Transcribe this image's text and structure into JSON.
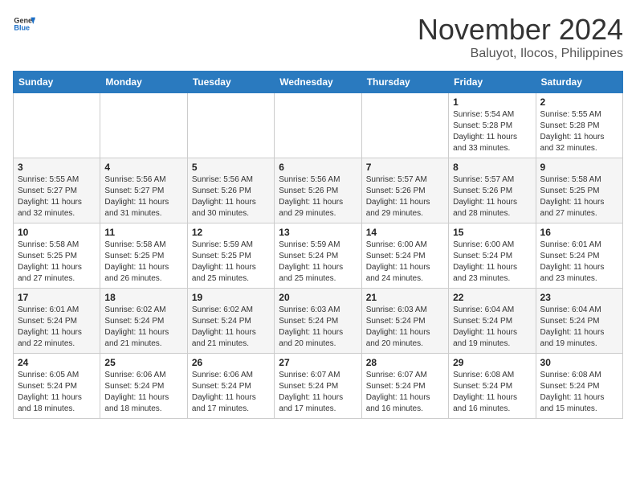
{
  "header": {
    "logo_general": "General",
    "logo_blue": "Blue",
    "month": "November 2024",
    "location": "Baluyot, Ilocos, Philippines"
  },
  "weekdays": [
    "Sunday",
    "Monday",
    "Tuesday",
    "Wednesday",
    "Thursday",
    "Friday",
    "Saturday"
  ],
  "weeks": [
    [
      {
        "day": "",
        "info": ""
      },
      {
        "day": "",
        "info": ""
      },
      {
        "day": "",
        "info": ""
      },
      {
        "day": "",
        "info": ""
      },
      {
        "day": "",
        "info": ""
      },
      {
        "day": "1",
        "info": "Sunrise: 5:54 AM\nSunset: 5:28 PM\nDaylight: 11 hours\nand 33 minutes."
      },
      {
        "day": "2",
        "info": "Sunrise: 5:55 AM\nSunset: 5:28 PM\nDaylight: 11 hours\nand 32 minutes."
      }
    ],
    [
      {
        "day": "3",
        "info": "Sunrise: 5:55 AM\nSunset: 5:27 PM\nDaylight: 11 hours\nand 32 minutes."
      },
      {
        "day": "4",
        "info": "Sunrise: 5:56 AM\nSunset: 5:27 PM\nDaylight: 11 hours\nand 31 minutes."
      },
      {
        "day": "5",
        "info": "Sunrise: 5:56 AM\nSunset: 5:26 PM\nDaylight: 11 hours\nand 30 minutes."
      },
      {
        "day": "6",
        "info": "Sunrise: 5:56 AM\nSunset: 5:26 PM\nDaylight: 11 hours\nand 29 minutes."
      },
      {
        "day": "7",
        "info": "Sunrise: 5:57 AM\nSunset: 5:26 PM\nDaylight: 11 hours\nand 29 minutes."
      },
      {
        "day": "8",
        "info": "Sunrise: 5:57 AM\nSunset: 5:26 PM\nDaylight: 11 hours\nand 28 minutes."
      },
      {
        "day": "9",
        "info": "Sunrise: 5:58 AM\nSunset: 5:25 PM\nDaylight: 11 hours\nand 27 minutes."
      }
    ],
    [
      {
        "day": "10",
        "info": "Sunrise: 5:58 AM\nSunset: 5:25 PM\nDaylight: 11 hours\nand 27 minutes."
      },
      {
        "day": "11",
        "info": "Sunrise: 5:58 AM\nSunset: 5:25 PM\nDaylight: 11 hours\nand 26 minutes."
      },
      {
        "day": "12",
        "info": "Sunrise: 5:59 AM\nSunset: 5:25 PM\nDaylight: 11 hours\nand 25 minutes."
      },
      {
        "day": "13",
        "info": "Sunrise: 5:59 AM\nSunset: 5:24 PM\nDaylight: 11 hours\nand 25 minutes."
      },
      {
        "day": "14",
        "info": "Sunrise: 6:00 AM\nSunset: 5:24 PM\nDaylight: 11 hours\nand 24 minutes."
      },
      {
        "day": "15",
        "info": "Sunrise: 6:00 AM\nSunset: 5:24 PM\nDaylight: 11 hours\nand 23 minutes."
      },
      {
        "day": "16",
        "info": "Sunrise: 6:01 AM\nSunset: 5:24 PM\nDaylight: 11 hours\nand 23 minutes."
      }
    ],
    [
      {
        "day": "17",
        "info": "Sunrise: 6:01 AM\nSunset: 5:24 PM\nDaylight: 11 hours\nand 22 minutes."
      },
      {
        "day": "18",
        "info": "Sunrise: 6:02 AM\nSunset: 5:24 PM\nDaylight: 11 hours\nand 21 minutes."
      },
      {
        "day": "19",
        "info": "Sunrise: 6:02 AM\nSunset: 5:24 PM\nDaylight: 11 hours\nand 21 minutes."
      },
      {
        "day": "20",
        "info": "Sunrise: 6:03 AM\nSunset: 5:24 PM\nDaylight: 11 hours\nand 20 minutes."
      },
      {
        "day": "21",
        "info": "Sunrise: 6:03 AM\nSunset: 5:24 PM\nDaylight: 11 hours\nand 20 minutes."
      },
      {
        "day": "22",
        "info": "Sunrise: 6:04 AM\nSunset: 5:24 PM\nDaylight: 11 hours\nand 19 minutes."
      },
      {
        "day": "23",
        "info": "Sunrise: 6:04 AM\nSunset: 5:24 PM\nDaylight: 11 hours\nand 19 minutes."
      }
    ],
    [
      {
        "day": "24",
        "info": "Sunrise: 6:05 AM\nSunset: 5:24 PM\nDaylight: 11 hours\nand 18 minutes."
      },
      {
        "day": "25",
        "info": "Sunrise: 6:06 AM\nSunset: 5:24 PM\nDaylight: 11 hours\nand 18 minutes."
      },
      {
        "day": "26",
        "info": "Sunrise: 6:06 AM\nSunset: 5:24 PM\nDaylight: 11 hours\nand 17 minutes."
      },
      {
        "day": "27",
        "info": "Sunrise: 6:07 AM\nSunset: 5:24 PM\nDaylight: 11 hours\nand 17 minutes."
      },
      {
        "day": "28",
        "info": "Sunrise: 6:07 AM\nSunset: 5:24 PM\nDaylight: 11 hours\nand 16 minutes."
      },
      {
        "day": "29",
        "info": "Sunrise: 6:08 AM\nSunset: 5:24 PM\nDaylight: 11 hours\nand 16 minutes."
      },
      {
        "day": "30",
        "info": "Sunrise: 6:08 AM\nSunset: 5:24 PM\nDaylight: 11 hours\nand 15 minutes."
      }
    ]
  ]
}
